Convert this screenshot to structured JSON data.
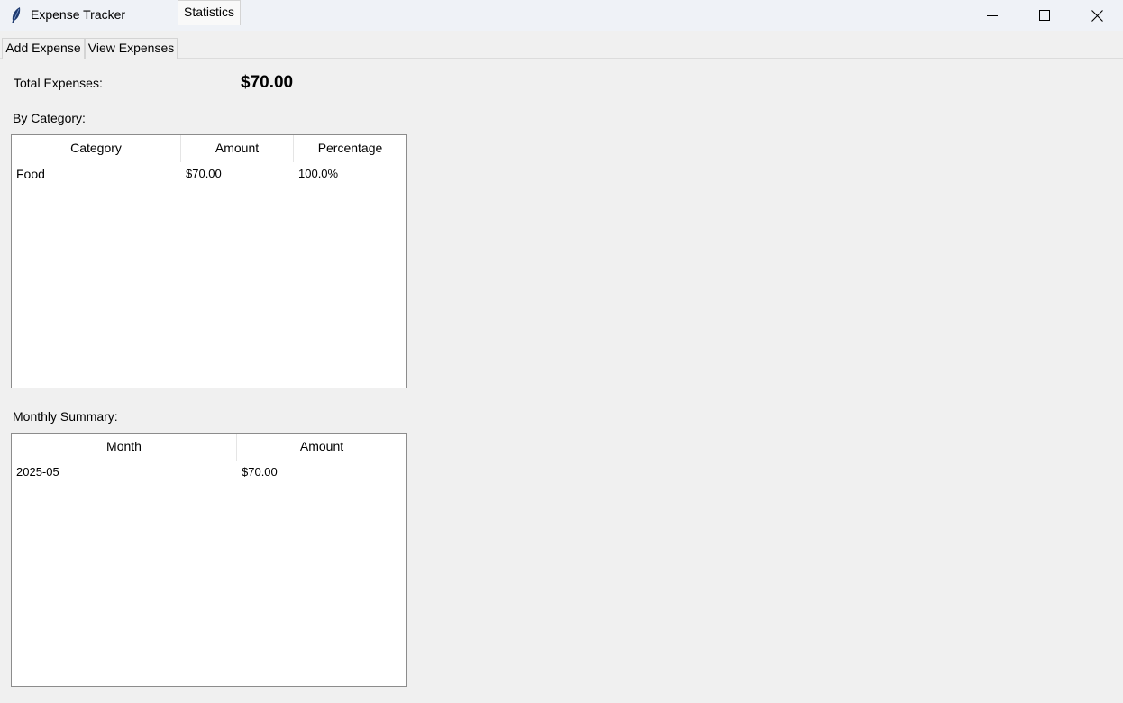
{
  "window": {
    "title": "Expense Tracker",
    "icon": "feather-icon",
    "controls": [
      "minimize-icon",
      "maximize-icon",
      "close-icon"
    ]
  },
  "tabs": [
    {
      "label": "Add Expense",
      "selected": false
    },
    {
      "label": "View Expenses",
      "selected": false
    },
    {
      "label": "Statistics",
      "selected": true
    }
  ],
  "statistics": {
    "total_label": "Total Expenses:",
    "total_value": "$70.00",
    "by_category_label": "By Category:",
    "category_table": {
      "columns": [
        "Category",
        "Amount",
        "Percentage"
      ],
      "rows": [
        [
          "Food",
          "$70.00",
          "100.0%"
        ]
      ]
    },
    "monthly_summary_label": "Monthly Summary:",
    "monthly_table": {
      "columns": [
        "Month",
        "Amount"
      ],
      "rows": [
        [
          "2025-05",
          "$70.00"
        ]
      ]
    }
  }
}
